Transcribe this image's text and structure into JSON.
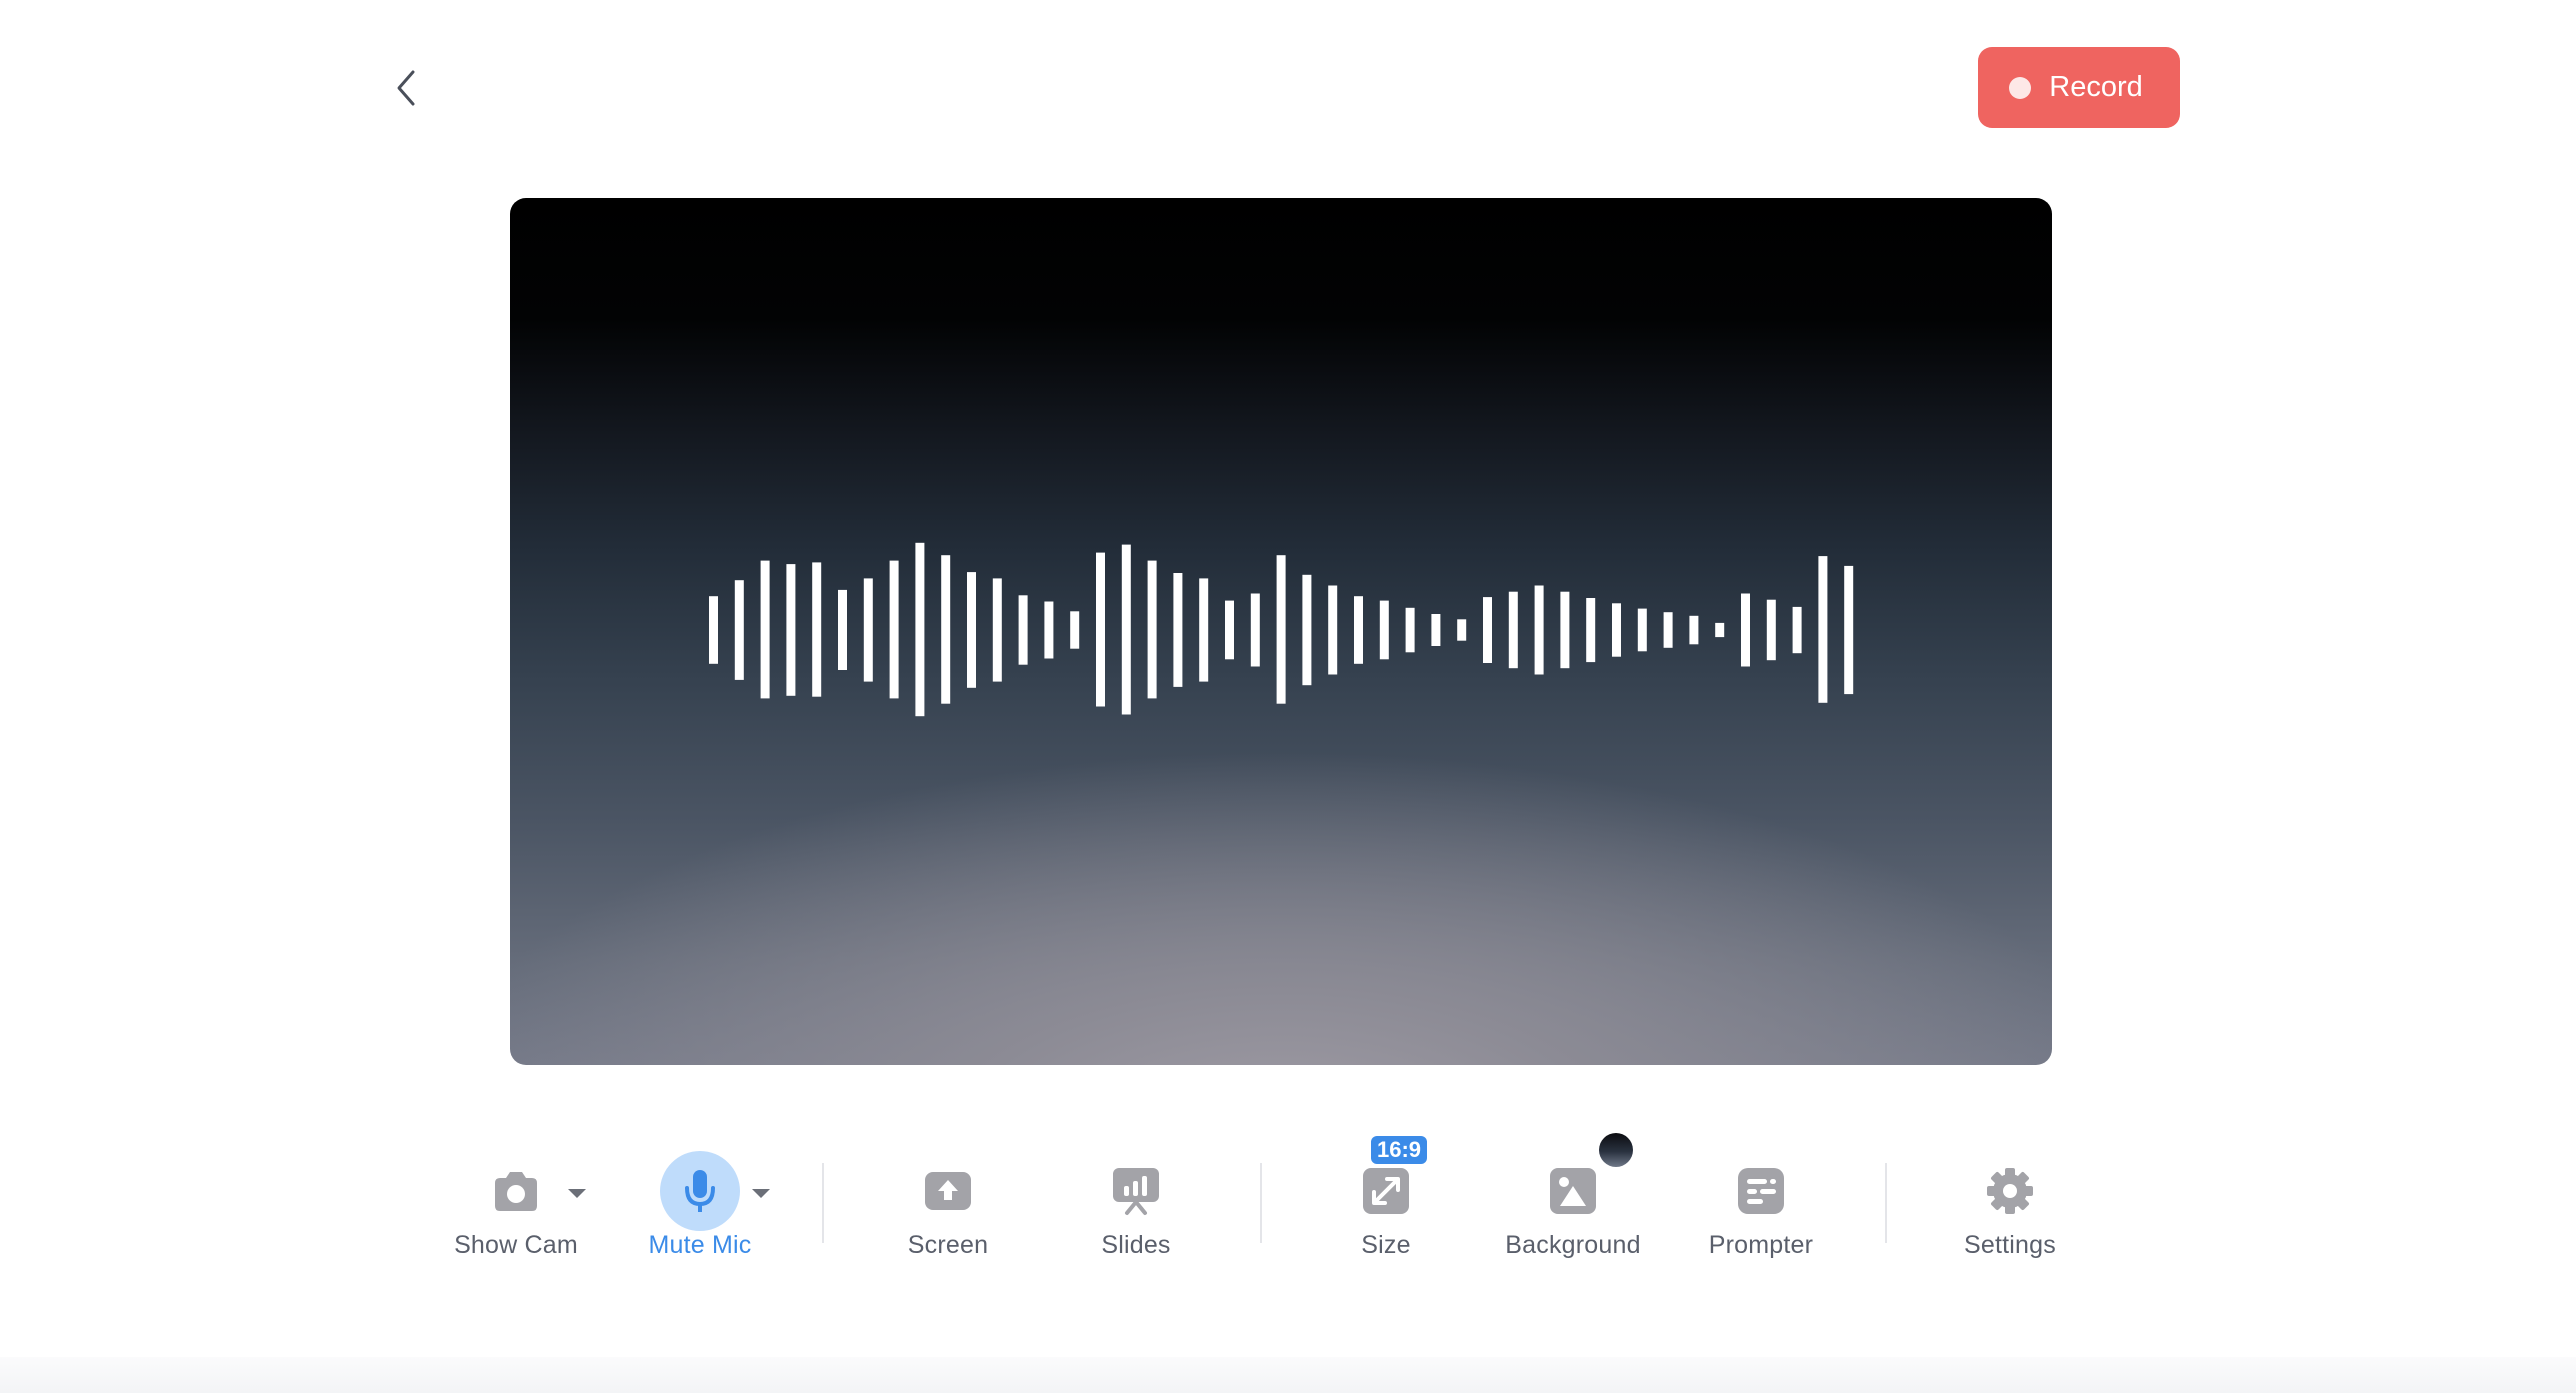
{
  "header": {
    "record_label": "Record",
    "back_icon": "chevron-left-icon"
  },
  "preview": {
    "type": "audio-waveform",
    "waveform_levels": [
      0.38,
      0.56,
      0.78,
      0.74,
      0.76,
      0.45,
      0.58,
      0.78,
      0.98,
      0.84,
      0.65,
      0.58,
      0.39,
      0.32,
      0.21,
      0.87,
      0.96,
      0.78,
      0.64,
      0.58,
      0.33,
      0.41,
      0.84,
      0.62,
      0.5,
      0.38,
      0.33,
      0.25,
      0.18,
      0.12,
      0.37,
      0.43,
      0.5,
      0.43,
      0.36,
      0.3,
      0.24,
      0.2,
      0.16,
      0.08,
      0.41,
      0.34,
      0.26,
      0.83,
      0.72
    ]
  },
  "toolbar": {
    "show_cam": {
      "label": "Show Cam",
      "icon": "camera-icon"
    },
    "mute_mic": {
      "label": "Mute Mic",
      "icon": "microphone-icon",
      "active": true
    },
    "screen": {
      "label": "Screen",
      "icon": "screen-share-icon"
    },
    "slides": {
      "label": "Slides",
      "icon": "slides-icon"
    },
    "size": {
      "label": "Size",
      "icon": "resize-icon",
      "badge": "16:9"
    },
    "background": {
      "label": "Background",
      "icon": "image-icon"
    },
    "prompter": {
      "label": "Prompter",
      "icon": "prompter-icon"
    },
    "settings": {
      "label": "Settings",
      "icon": "gear-icon"
    }
  },
  "colors": {
    "record": "#ef6460",
    "accent": "#3b8be8",
    "accent_light": "#bfdcfb",
    "icon_gray": "#a3a3a8"
  }
}
